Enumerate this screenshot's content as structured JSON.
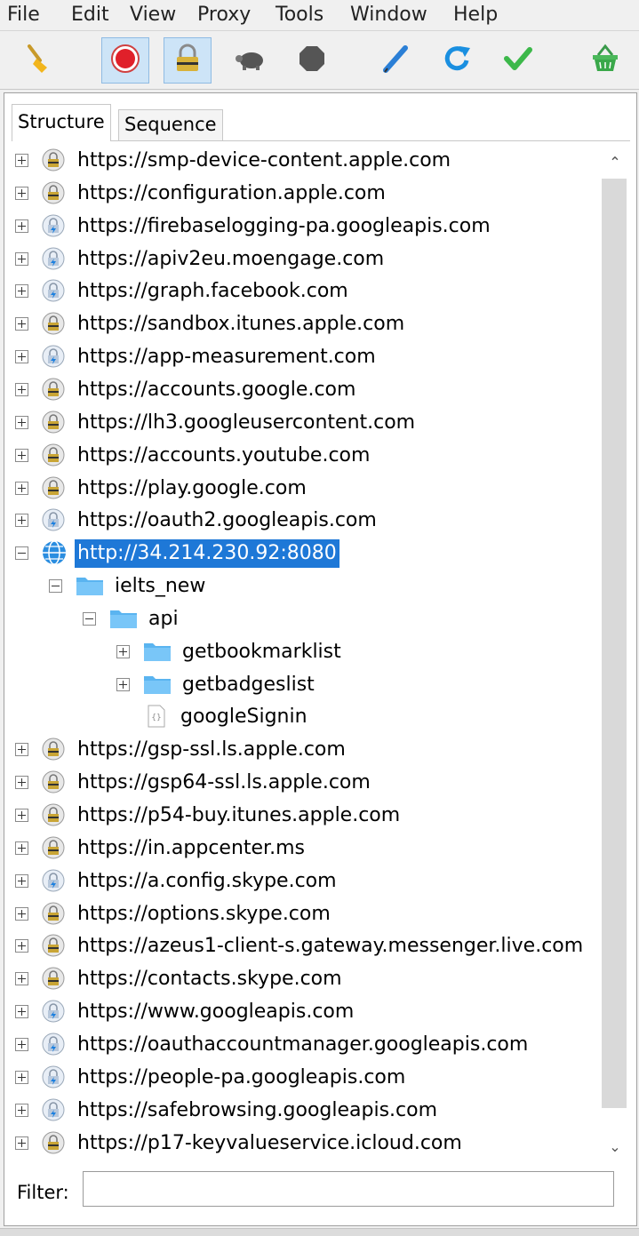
{
  "menu": [
    "File",
    "Edit",
    "View",
    "Proxy",
    "Tools",
    "Window",
    "Help"
  ],
  "toolbar": {
    "buttons": [
      {
        "icon": "broom-icon",
        "pressed": false
      },
      {
        "icon": "record-icon",
        "pressed": true
      },
      {
        "icon": "ssl-proxy-lock-icon",
        "pressed": true
      },
      {
        "icon": "throttle-turtle-icon",
        "pressed": false
      },
      {
        "icon": "breakpoint-stop-icon",
        "pressed": false
      },
      {
        "icon": "compose-pen-icon",
        "pressed": false
      },
      {
        "icon": "repeat-refresh-icon",
        "pressed": false
      },
      {
        "icon": "validate-check-icon",
        "pressed": false
      },
      {
        "icon": "basket-icon",
        "pressed": false
      }
    ]
  },
  "tabs": {
    "structure": "Structure",
    "sequence": "Sequence"
  },
  "tree": [
    {
      "label": "https://smp-device-content.apple.com",
      "type": "lock",
      "level": 0,
      "exp": "plus"
    },
    {
      "label": "https://configuration.apple.com",
      "type": "lock",
      "level": 0,
      "exp": "plus"
    },
    {
      "label": "https://firebaselogging-pa.googleapis.com",
      "type": "bolt",
      "level": 0,
      "exp": "plus"
    },
    {
      "label": "https://apiv2eu.moengage.com",
      "type": "bolt",
      "level": 0,
      "exp": "plus"
    },
    {
      "label": "https://graph.facebook.com",
      "type": "bolt",
      "level": 0,
      "exp": "plus"
    },
    {
      "label": "https://sandbox.itunes.apple.com",
      "type": "lock",
      "level": 0,
      "exp": "plus"
    },
    {
      "label": "https://app-measurement.com",
      "type": "bolt",
      "level": 0,
      "exp": "plus"
    },
    {
      "label": "https://accounts.google.com",
      "type": "lock",
      "level": 0,
      "exp": "plus"
    },
    {
      "label": "https://lh3.googleusercontent.com",
      "type": "lock",
      "level": 0,
      "exp": "plus"
    },
    {
      "label": "https://accounts.youtube.com",
      "type": "lock",
      "level": 0,
      "exp": "plus"
    },
    {
      "label": "https://play.google.com",
      "type": "lock",
      "level": 0,
      "exp": "plus"
    },
    {
      "label": "https://oauth2.googleapis.com",
      "type": "bolt",
      "level": 0,
      "exp": "plus"
    },
    {
      "label": "http://34.214.230.92:8080",
      "type": "globe",
      "level": 0,
      "exp": "minus",
      "selected": true
    },
    {
      "label": "ielts_new",
      "type": "folder",
      "level": 1,
      "exp": "minus"
    },
    {
      "label": "api",
      "type": "folder",
      "level": 2,
      "exp": "minus"
    },
    {
      "label": "getbookmarklist",
      "type": "folder",
      "level": 3,
      "exp": "plus"
    },
    {
      "label": "getbadgeslist",
      "type": "folder",
      "level": 3,
      "exp": "plus"
    },
    {
      "label": "googleSignin",
      "type": "json",
      "level": 3,
      "exp": "none"
    },
    {
      "label": "https://gsp-ssl.ls.apple.com",
      "type": "lock",
      "level": 0,
      "exp": "plus"
    },
    {
      "label": "https://gsp64-ssl.ls.apple.com",
      "type": "lock",
      "level": 0,
      "exp": "plus"
    },
    {
      "label": "https://p54-buy.itunes.apple.com",
      "type": "lock",
      "level": 0,
      "exp": "plus"
    },
    {
      "label": "https://in.appcenter.ms",
      "type": "lock",
      "level": 0,
      "exp": "plus"
    },
    {
      "label": "https://a.config.skype.com",
      "type": "bolt",
      "level": 0,
      "exp": "plus"
    },
    {
      "label": "https://options.skype.com",
      "type": "lock",
      "level": 0,
      "exp": "plus"
    },
    {
      "label": "https://azeus1-client-s.gateway.messenger.live.com",
      "type": "lock",
      "level": 0,
      "exp": "plus"
    },
    {
      "label": "https://contacts.skype.com",
      "type": "lock",
      "level": 0,
      "exp": "plus"
    },
    {
      "label": "https://www.googleapis.com",
      "type": "bolt",
      "level": 0,
      "exp": "plus"
    },
    {
      "label": "https://oauthaccountmanager.googleapis.com",
      "type": "bolt",
      "level": 0,
      "exp": "plus"
    },
    {
      "label": "https://people-pa.googleapis.com",
      "type": "bolt",
      "level": 0,
      "exp": "plus"
    },
    {
      "label": "https://safebrowsing.googleapis.com",
      "type": "bolt",
      "level": 0,
      "exp": "plus"
    },
    {
      "label": "https://p17-keyvalueservice.icloud.com",
      "type": "lock",
      "level": 0,
      "exp": "plus"
    }
  ],
  "filter": {
    "label": "Filter:",
    "value": ""
  },
  "colors": {
    "selection": "#1e78d7",
    "folder": "#5ab4f0"
  }
}
